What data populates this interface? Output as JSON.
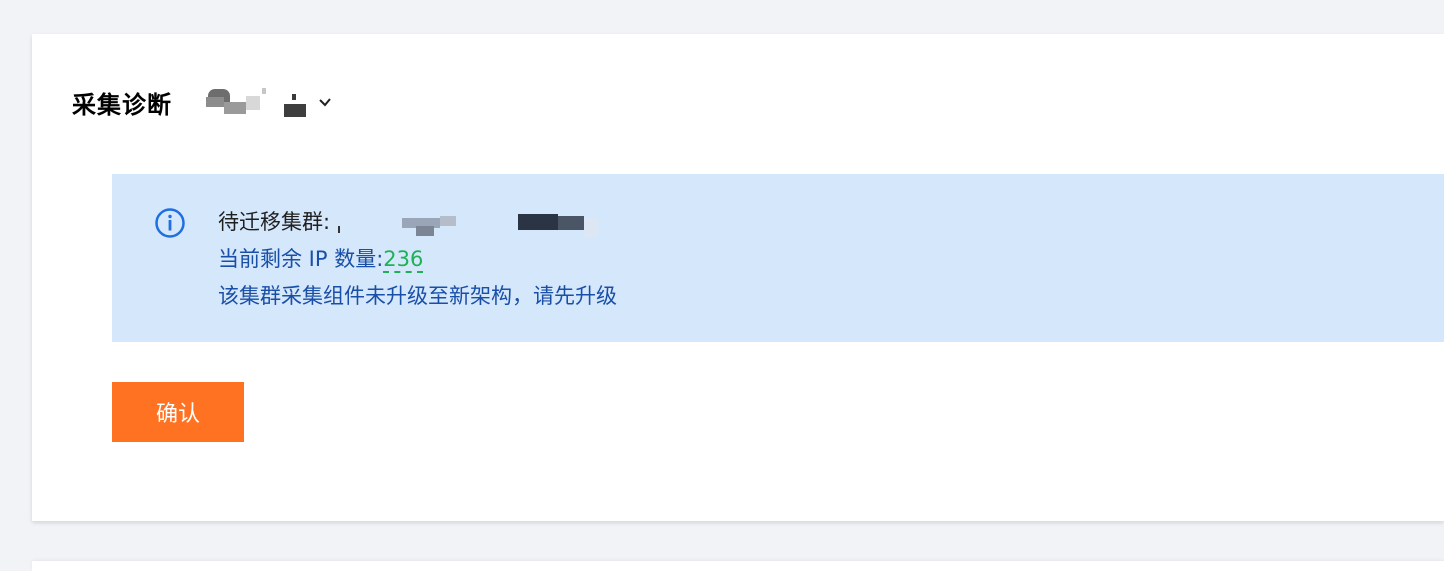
{
  "header": {
    "title": "采集诊断"
  },
  "alert": {
    "cluster_label": "待迁移集群:",
    "ip_label": "当前剩余 IP 数量:",
    "ip_count": "236",
    "message": "该集群采集组件未升级至新架构，请先升级",
    "icon": "info-icon"
  },
  "actions": {
    "confirm_label": "确认"
  },
  "colors": {
    "page_bg": "#f2f3f7",
    "alert_bg": "#d5e7fb",
    "accent_blue": "#1a4fa8",
    "count_green": "#1fb157",
    "button_orange": "#ff7222"
  }
}
